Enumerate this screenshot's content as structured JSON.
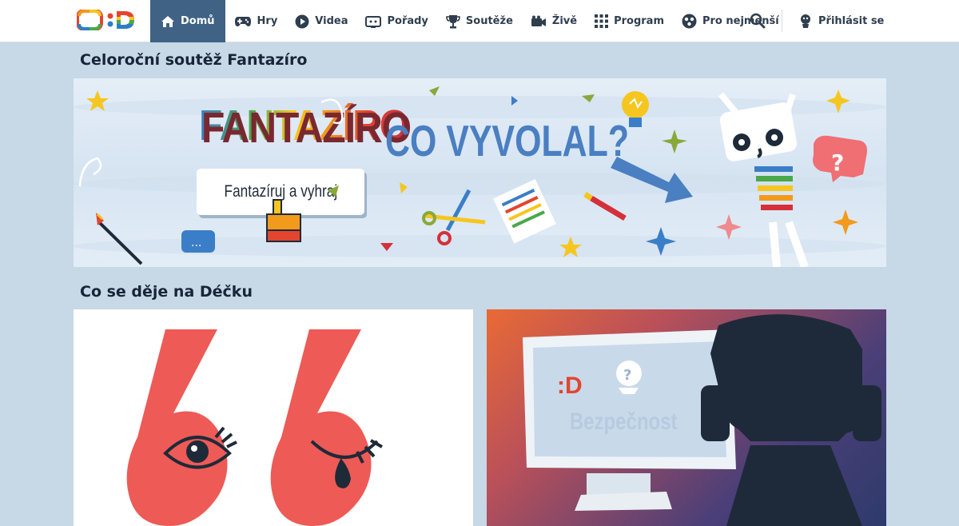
{
  "brand": {
    "logo_alt": "ČT :D",
    "colors": {
      "accent": "#3f6285",
      "background": "#c7d8e6",
      "red": "#ee5a56"
    }
  },
  "nav": {
    "items": [
      {
        "label": "Domů",
        "icon": "home-icon",
        "active": true
      },
      {
        "label": "Hry",
        "icon": "gamepad-icon"
      },
      {
        "label": "Videa",
        "icon": "play-icon"
      },
      {
        "label": "Pořady",
        "icon": "tv-icon"
      },
      {
        "label": "Soutěže",
        "icon": "trophy-icon"
      },
      {
        "label": "Živě",
        "icon": "camera-icon"
      },
      {
        "label": "Program",
        "icon": "grid-icon"
      },
      {
        "label": "Pro nejmenší",
        "icon": "toy-icon"
      }
    ],
    "search_icon": "search-icon",
    "login_label": "Přihlásit se",
    "login_icon": "user-icon"
  },
  "sections": {
    "contest_title": "Celoroční soutěž Fantazíro",
    "news_title": "Co se děje na Déčku"
  },
  "banner": {
    "logo_text": "FANTAZÍRO",
    "headline": "CO VYVOLAL?",
    "cta_label": "Fantazíruj a vyhraj"
  },
  "cards": [
    {
      "name": "quote-marks-card",
      "icon": "quote-marks-icon"
    },
    {
      "name": "bezpecnost-card",
      "label": "Bezpečnost",
      "logo_text": ":D"
    }
  ]
}
